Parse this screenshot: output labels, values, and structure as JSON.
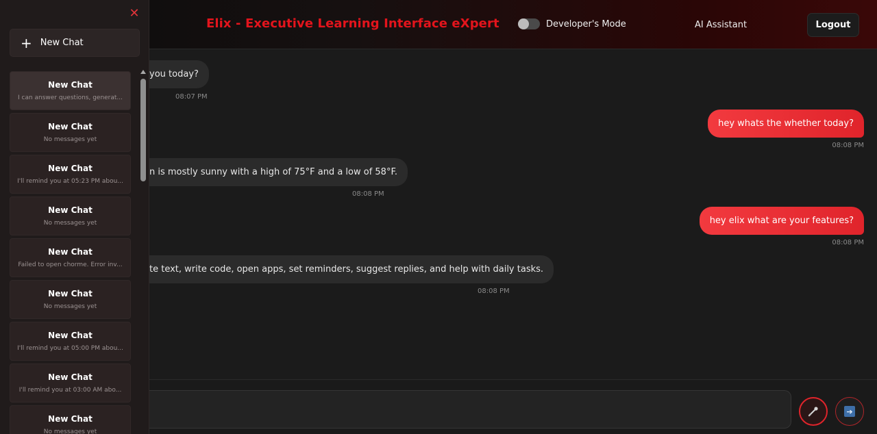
{
  "header": {
    "title": "Elix - Executive Learning Interface eXpert",
    "dev_mode_label": "Developer's Mode",
    "ai_label": "AI Assistant",
    "logout_label": "Logout"
  },
  "messages": [
    {
      "role": "bot",
      "text": "you today?",
      "time": "08:07 PM"
    },
    {
      "role": "user",
      "text": "hey whats the whether today?",
      "time": "08:08 PM"
    },
    {
      "role": "bot",
      "text": "n is mostly sunny with a high of 75°F and a low of 58°F.",
      "time": "08:08 PM"
    },
    {
      "role": "user",
      "text": "hey elix what are your features?",
      "time": "08:08 PM"
    },
    {
      "role": "bot",
      "text": "te text, write code, open apps, set reminders, suggest replies, and help with daily tasks.",
      "time": "08:08 PM"
    }
  ],
  "input": {
    "placeholder": ""
  },
  "sidebar": {
    "new_chat_label": "New Chat",
    "chats": [
      {
        "title": "New Chat",
        "preview": "I can answer questions, generat..."
      },
      {
        "title": "New Chat",
        "preview": "No messages yet"
      },
      {
        "title": "New Chat",
        "preview": "I'll remind you at 05:23 PM abou..."
      },
      {
        "title": "New Chat",
        "preview": "No messages yet"
      },
      {
        "title": "New Chat",
        "preview": "Failed to open chorme. Error inv..."
      },
      {
        "title": "New Chat",
        "preview": "No messages yet"
      },
      {
        "title": "New Chat",
        "preview": "I'll remind you at 05:00 PM abou..."
      },
      {
        "title": "New Chat",
        "preview": "I'll remind you at 03:00 AM abo..."
      },
      {
        "title": "New Chat",
        "preview": "No messages yet"
      }
    ]
  },
  "colors": {
    "accent": "#e3141c",
    "user_bubble": "#f23a3f",
    "bot_bubble": "#2b2b2b",
    "background": "#1b1b1b",
    "sidebar": "#201b1b"
  }
}
